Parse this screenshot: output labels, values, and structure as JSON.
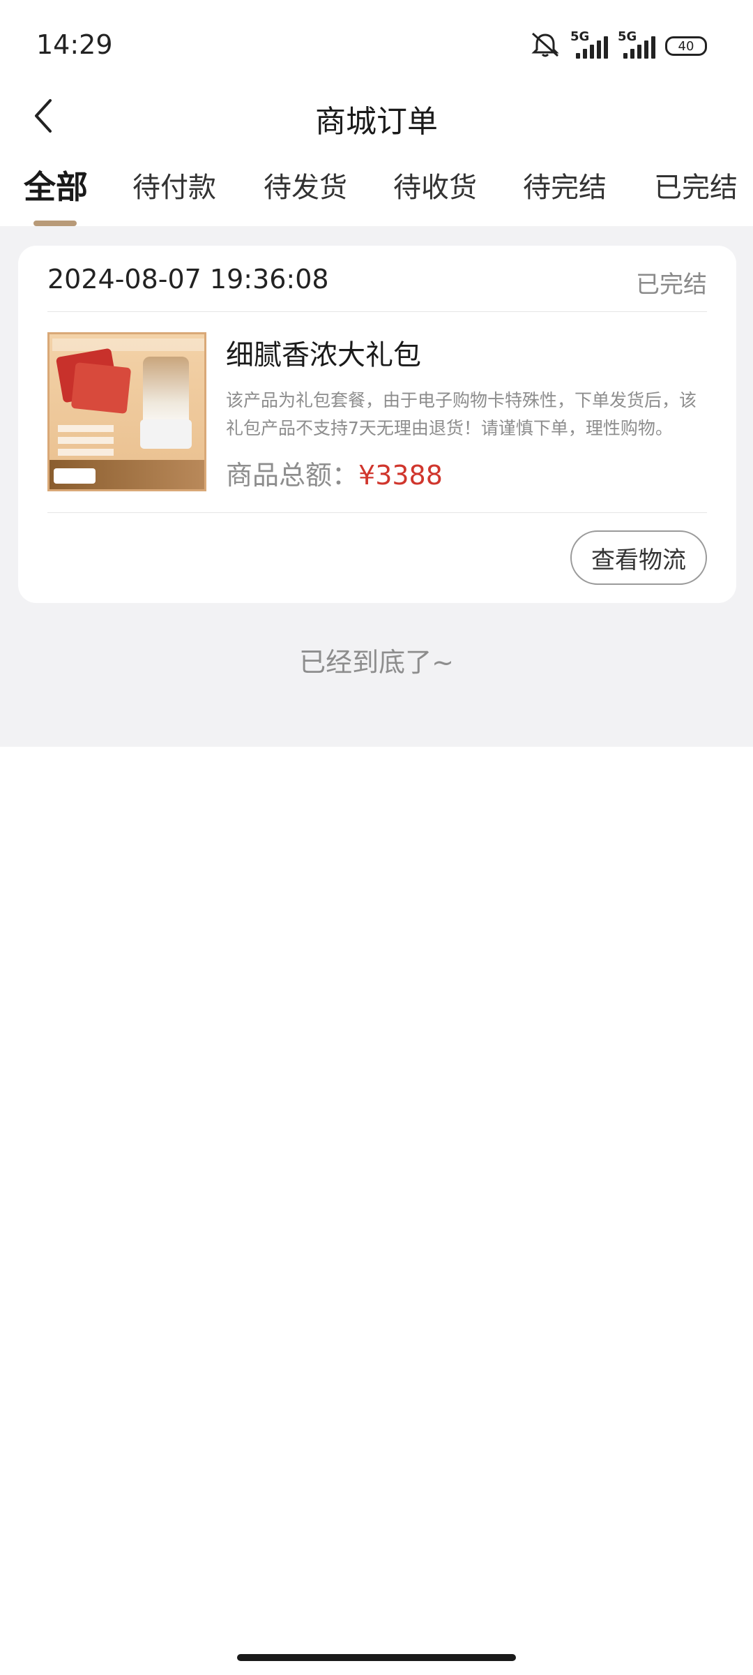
{
  "status_bar": {
    "time": "14:29",
    "signal_1": "5G",
    "signal_2": "5G",
    "battery": "40",
    "icons": [
      "mute-icon",
      "signal-icon",
      "signal-icon",
      "battery-icon"
    ]
  },
  "header": {
    "title": "商城订单",
    "back_icon": "chevron-left-icon"
  },
  "tabs": {
    "items": [
      {
        "label": "全部",
        "active": true
      },
      {
        "label": "待付款",
        "active": false
      },
      {
        "label": "待发货",
        "active": false
      },
      {
        "label": "待收货",
        "active": false
      },
      {
        "label": "待完结",
        "active": false
      },
      {
        "label": "已完结",
        "active": false
      }
    ],
    "accent_color": "#b89a78"
  },
  "orders": [
    {
      "time": "2024-08-07 19:36:08",
      "status": "已完结",
      "product_name": "细腻香浓大礼包",
      "description": "该产品为礼包套餐，由于电子购物卡特殊性，下单发货后，该礼包产品不支持7天无理由退货！请谨慎下单，理性购物。",
      "total_label": "商品总额：",
      "total_amount": "¥3388",
      "action_label": "查看物流"
    }
  ],
  "list_end_text": "已经到底了~",
  "colors": {
    "price": "#d0362d",
    "list_background": "#f2f2f4",
    "muted_text": "#8d8d8d"
  }
}
